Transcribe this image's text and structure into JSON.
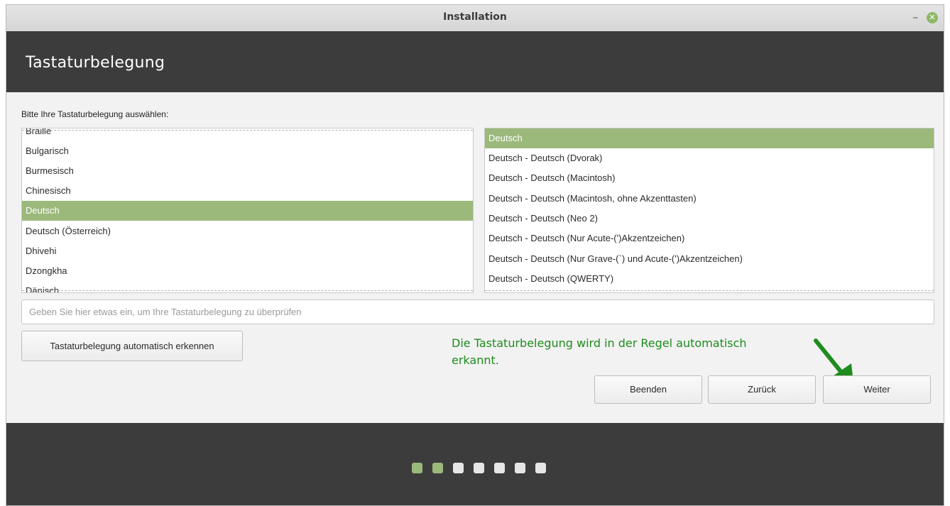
{
  "window": {
    "title": "Installation"
  },
  "header": {
    "title": "Tastaturbelegung"
  },
  "prompt": "Bitte Ihre Tastaturbelegung auswählen:",
  "languages": {
    "items": [
      {
        "label": "Braille",
        "selected": false
      },
      {
        "label": "Bulgarisch",
        "selected": false
      },
      {
        "label": "Burmesisch",
        "selected": false
      },
      {
        "label": "Chinesisch",
        "selected": false
      },
      {
        "label": "Deutsch",
        "selected": true
      },
      {
        "label": "Deutsch (Österreich)",
        "selected": false
      },
      {
        "label": "Dhivehi",
        "selected": false
      },
      {
        "label": "Dzongkha",
        "selected": false
      },
      {
        "label": "Dänisch",
        "selected": false
      }
    ]
  },
  "variants": {
    "items": [
      {
        "label": "Deutsch",
        "selected": true
      },
      {
        "label": "Deutsch - Deutsch (Dvorak)",
        "selected": false
      },
      {
        "label": "Deutsch - Deutsch (Macintosh)",
        "selected": false
      },
      {
        "label": "Deutsch - Deutsch (Macintosh, ohne Akzenttasten)",
        "selected": false
      },
      {
        "label": "Deutsch - Deutsch (Neo 2)",
        "selected": false
      },
      {
        "label": "Deutsch - Deutsch (Nur Acute-(')Akzentzeichen)",
        "selected": false
      },
      {
        "label": "Deutsch - Deutsch (Nur Grave-(`) und Acute-(')Akzentzeichen)",
        "selected": false
      },
      {
        "label": "Deutsch - Deutsch (QWERTY)",
        "selected": false
      }
    ]
  },
  "test_field": {
    "value": "",
    "placeholder": "Geben Sie hier etwas ein, um Ihre Tastaturbelegung zu überprüfen"
  },
  "buttons": {
    "detect": "Tastaturbelegung automatisch erkennen",
    "quit": "Beenden",
    "back": "Zurück",
    "next": "Weiter"
  },
  "annotation": {
    "text": "Die Tastaturbelegung wird in der Regel automatisch erkannt.",
    "color": "#1e8c1e"
  },
  "progress": {
    "total_steps": 7,
    "completed_steps": 2
  },
  "colors": {
    "accent": "#9bb97b",
    "header_bg": "#3c3c3c"
  }
}
